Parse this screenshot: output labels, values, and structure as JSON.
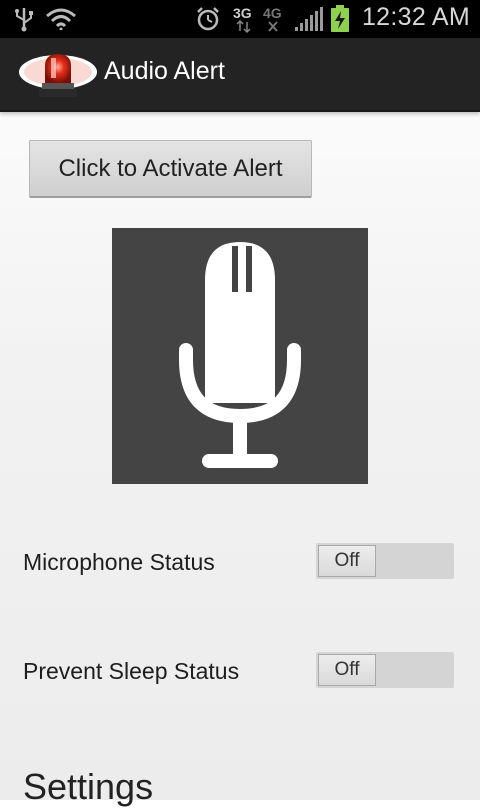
{
  "status_bar": {
    "time": "12:32 AM",
    "network_3g": "3G",
    "network_4g": "4G",
    "icons": [
      "usb-icon",
      "wifi-icon",
      "alarm-icon",
      "network-3g-icon",
      "network-4g-icon",
      "signal-icon",
      "battery-charging-icon"
    ]
  },
  "app": {
    "title": "Audio Alert",
    "icon": "alarm-siren-icon"
  },
  "main": {
    "activate_label": "Click to Activate Alert",
    "microphone": {
      "label": "Microphone Status",
      "toggle_state": "Off"
    },
    "prevent_sleep": {
      "label": "Prevent Sleep Status",
      "toggle_state": "Off"
    },
    "settings_heading": "Settings"
  }
}
